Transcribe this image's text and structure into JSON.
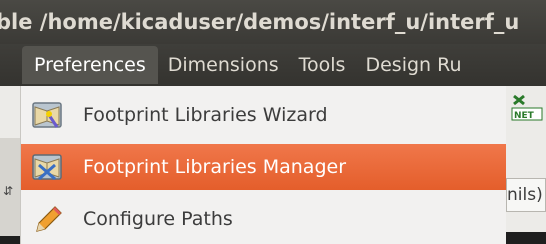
{
  "window": {
    "title": "ble /home/kicaduser/demos/interf_u/interf_u"
  },
  "menubar": {
    "items": [
      {
        "label": "Preferences",
        "active": true
      },
      {
        "label": "Dimensions",
        "active": false
      },
      {
        "label": "Tools",
        "active": false
      },
      {
        "label": "Design Ru",
        "active": false
      }
    ]
  },
  "dropdown": {
    "items": [
      {
        "label": "Footprint Libraries Wizard",
        "icon": "library-wizard-icon",
        "selected": false
      },
      {
        "label": "Footprint Libraries Manager",
        "icon": "library-manager-icon",
        "selected": true
      },
      {
        "label": "Configure Paths",
        "icon": "pencil-icon",
        "selected": false
      }
    ]
  },
  "background": {
    "units_field": "nils)"
  },
  "colors": {
    "highlight": "#e9652f",
    "menu_bg": "#f2f1f0",
    "titlebar_text": "#dfdbd2"
  }
}
